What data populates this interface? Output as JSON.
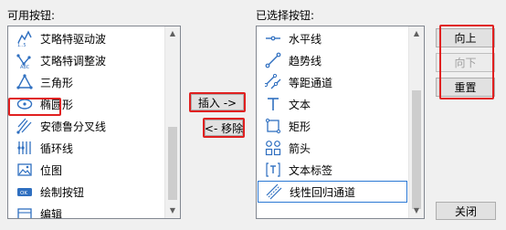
{
  "available": {
    "label": "可用按钮:",
    "items": [
      {
        "label": "艾略特驱动波",
        "icon": "elliott-impulse-wave-icon"
      },
      {
        "label": "艾略特调整波",
        "icon": "elliott-correction-wave-icon"
      },
      {
        "label": "三角形",
        "icon": "triangle-icon"
      },
      {
        "label": "椭圆形",
        "icon": "ellipse-icon",
        "highlighted": true
      },
      {
        "label": "安德鲁分叉线",
        "icon": "andrews-pitchfork-icon"
      },
      {
        "label": "循环线",
        "icon": "cycle-lines-icon"
      },
      {
        "label": "位图",
        "icon": "bitmap-icon"
      },
      {
        "label": "绘制按钮",
        "icon": "draw-button-icon"
      },
      {
        "label": "编辑",
        "icon": "edit-icon"
      }
    ]
  },
  "selected": {
    "label": "已选择按钮:",
    "items": [
      {
        "label": "水平线",
        "icon": "horizontal-line-icon"
      },
      {
        "label": "趋势线",
        "icon": "trend-line-icon"
      },
      {
        "label": "等距通道",
        "icon": "equidistant-channel-icon"
      },
      {
        "label": "文本",
        "icon": "text-icon"
      },
      {
        "label": "矩形",
        "icon": "rectangle-icon"
      },
      {
        "label": "箭头",
        "icon": "arrow-icon"
      },
      {
        "label": "文本标签",
        "icon": "text-label-icon"
      },
      {
        "label": "线性回归通道",
        "icon": "linear-regression-channel-icon",
        "selected": true
      }
    ]
  },
  "buttons": {
    "insert": "插入 ->",
    "remove": "<- 移除",
    "move_up": "向上",
    "move_down": "向下",
    "reset": "重置",
    "close": "关闭"
  },
  "colors": {
    "icon_blue": "#2f6fc0",
    "highlight_red": "#e02020",
    "selection_border": "#2b78d4"
  }
}
